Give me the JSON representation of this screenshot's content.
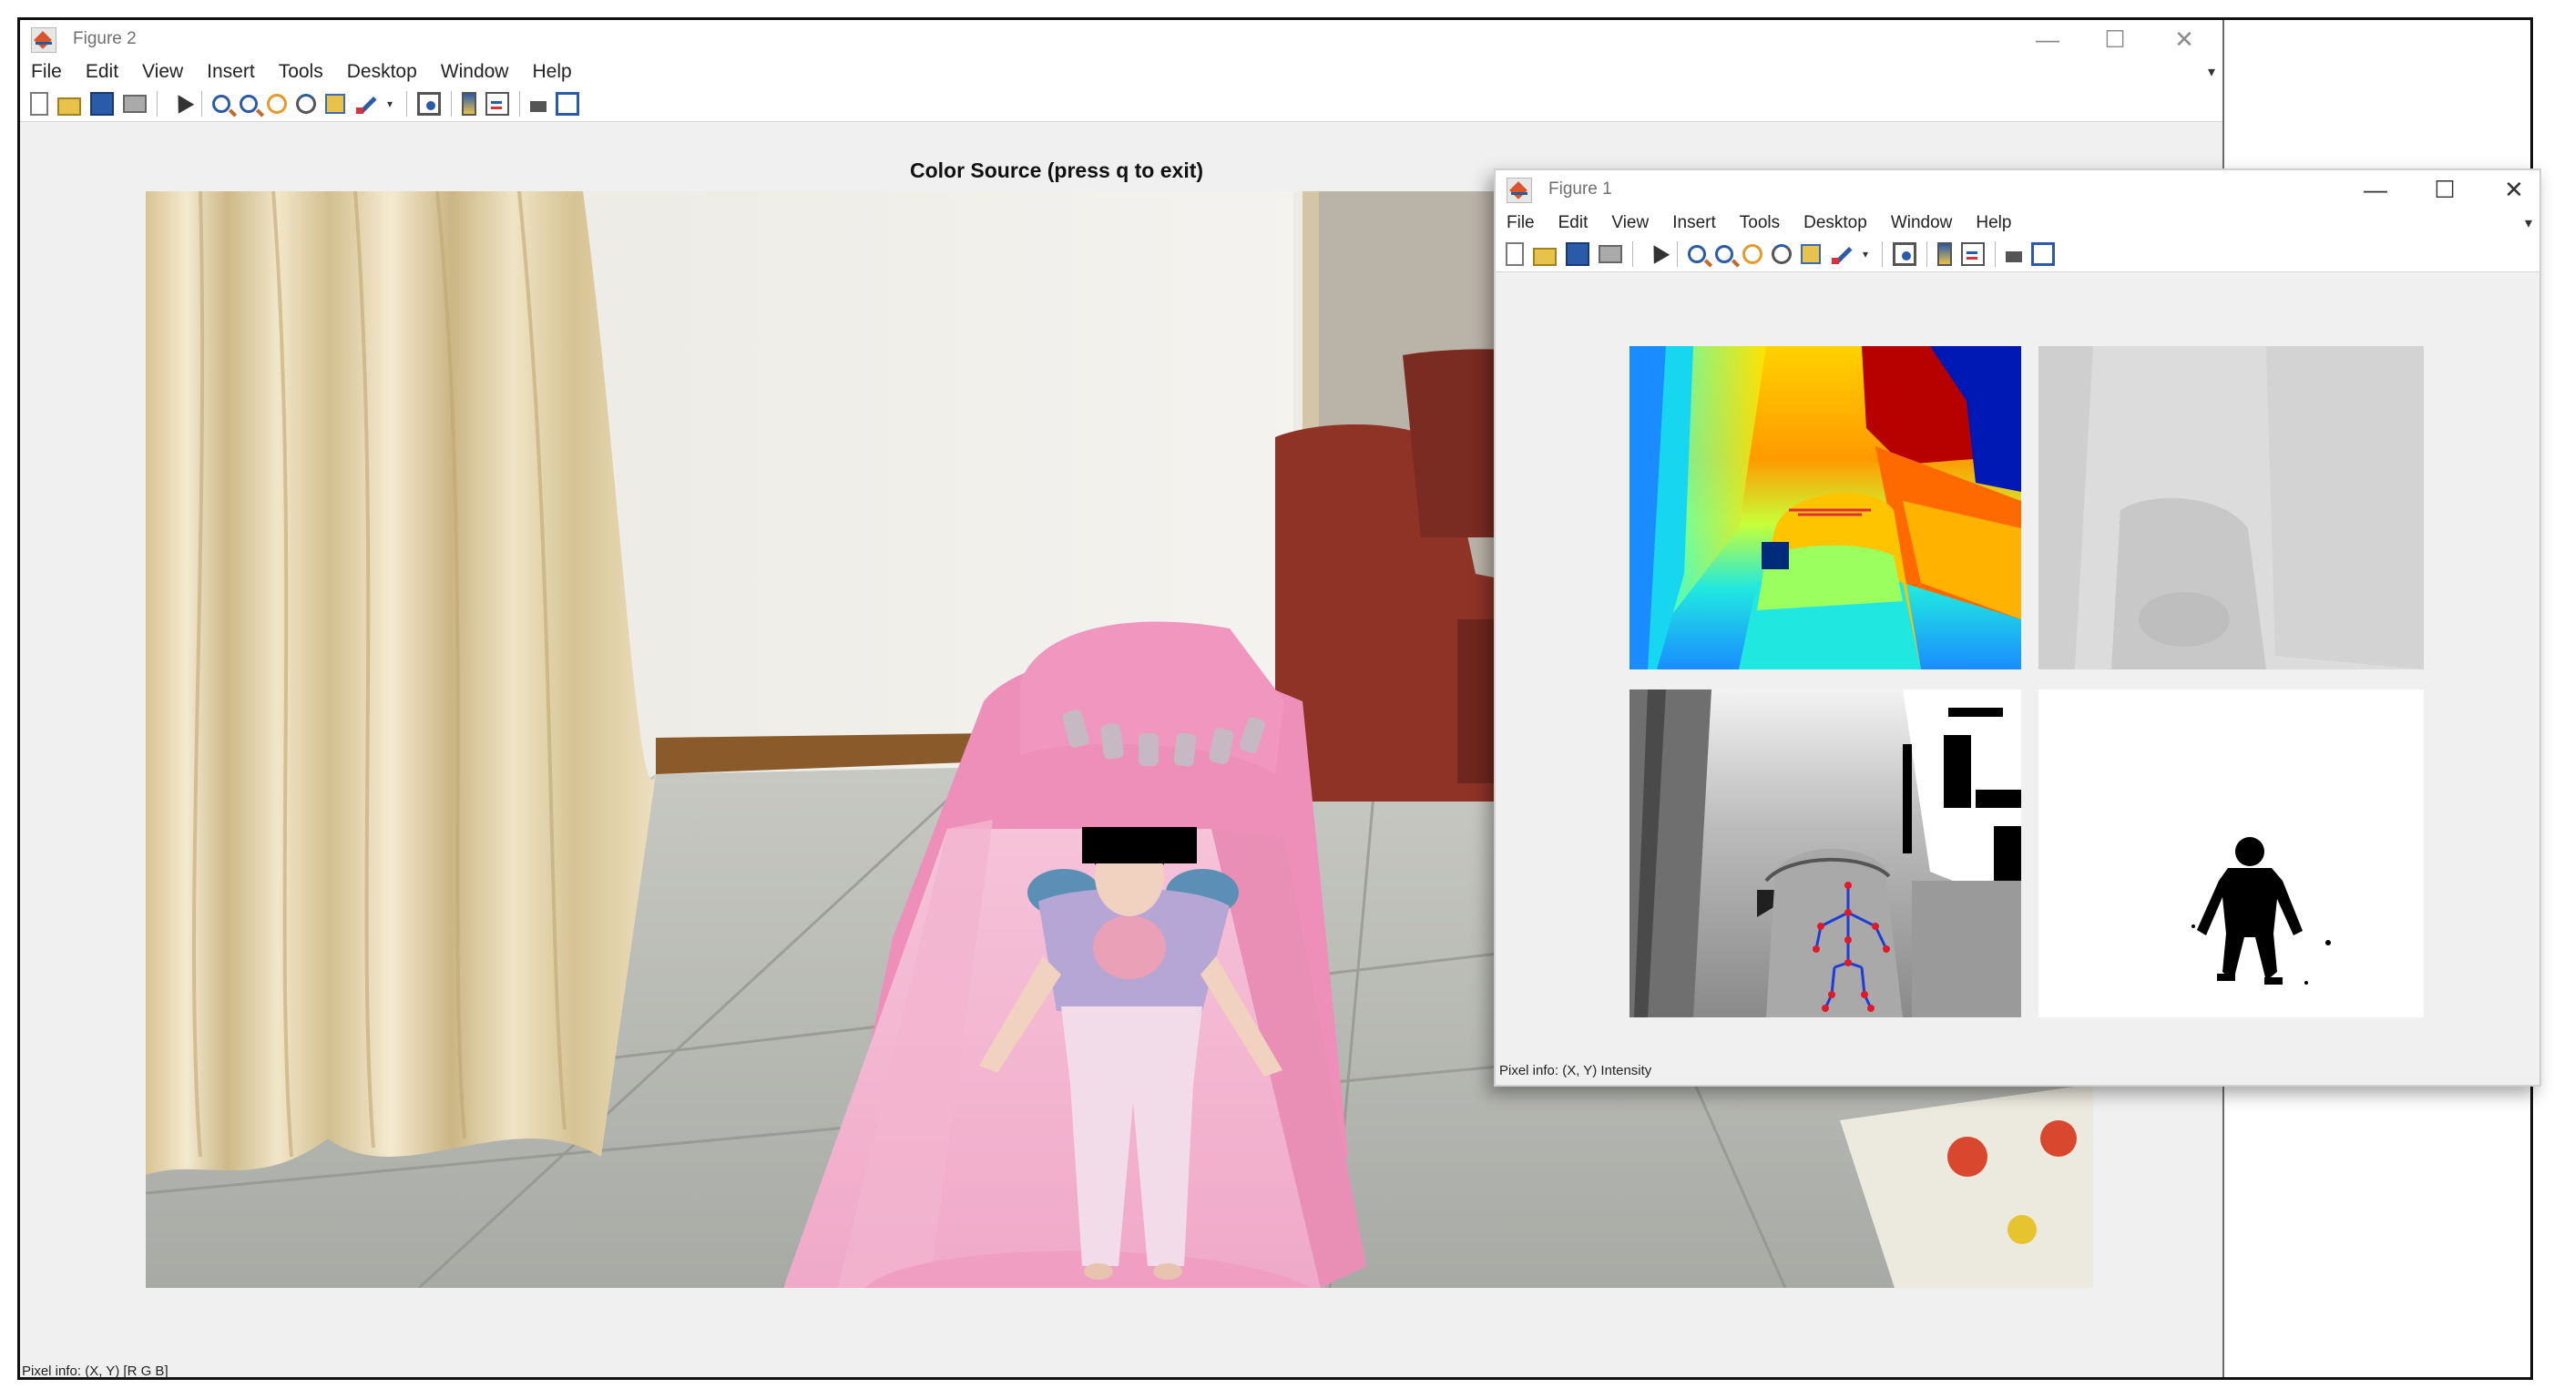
{
  "main_window": {
    "title": "Figure 2",
    "menu": [
      "File",
      "Edit",
      "View",
      "Insert",
      "Tools",
      "Desktop",
      "Window",
      "Help"
    ],
    "axes_title": "Color Source (press q to exit)",
    "status": "Pixel info: (X, Y) [R G B]"
  },
  "figure1_window": {
    "title": "Figure 1",
    "menu": [
      "File",
      "Edit",
      "View",
      "Insert",
      "Tools",
      "Desktop",
      "Window",
      "Help"
    ],
    "status": "Pixel info: (X, Y) Intensity"
  },
  "window_controls": {
    "minimize": "—",
    "maximize": "☐",
    "close": "✕"
  },
  "toolbar_icons": [
    "new-figure-icon",
    "open-file-icon",
    "save-icon",
    "print-icon",
    "edit-plot-arrow-icon",
    "zoom-in-icon",
    "zoom-out-icon",
    "pan-icon",
    "rotate-3d-icon",
    "data-cursor-icon",
    "brush-icon",
    "link-plot-icon",
    "insert-colorbar-icon",
    "insert-legend-icon",
    "hide-plot-tools-icon",
    "show-plot-tools-icon"
  ],
  "colors": {
    "window_bg": "#f0f0f0",
    "bed_pink": "#f2a3c6",
    "curtain": "#e8d8b4",
    "jet_red": "#b70000",
    "jet_yellow": "#f6e800",
    "jet_cyan": "#20e8e0",
    "jet_blue": "#0019b5",
    "skeleton_blue": "#1f3bd8",
    "skeleton_joint": "#e11a2a"
  }
}
